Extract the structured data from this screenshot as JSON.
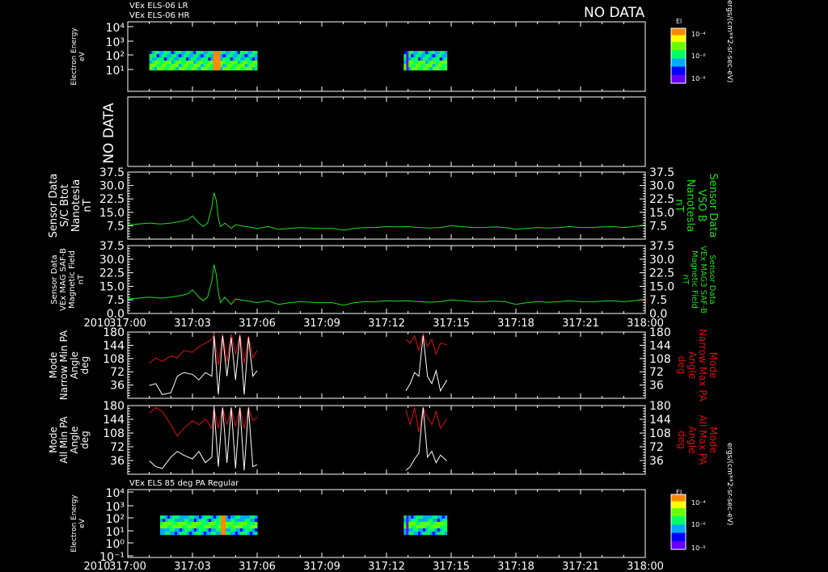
{
  "header": {
    "line1": "VEx ELS-06 LR",
    "line2": "VEx ELS-06 HR",
    "nodata": "NO DATA",
    "footer_title": "VEx ELS 85 deg PA Regular"
  },
  "colorbar": {
    "title": "El",
    "ticks": [
      "10⁻⁴",
      "10⁻⁶",
      "10⁻⁸"
    ],
    "unit": "ergs/(cm**2-sr-sec-eV)"
  },
  "colors": {
    "background": "#000000",
    "axes": "#ffffff",
    "green": "#22dd22",
    "red": "#dd1111",
    "white": "#ffffff"
  },
  "chart_data": [
    {
      "type": "heatmap",
      "name": "energy_top",
      "ylabel": "Electron Energy\neV",
      "yticks": [
        "10⁴",
        "10³",
        "10²",
        "10¹"
      ],
      "data_segments": [
        [
          "317:01",
          "317:06"
        ],
        [
          "317:12.8",
          "317:14.8"
        ]
      ],
      "note": "color spectrogram"
    },
    {
      "type": "line",
      "name": "nodata_panel",
      "ylabel": "NO DATA"
    },
    {
      "type": "line",
      "name": "bmag_sc",
      "ylabel_left": "Sensor Data\nS/C Btot\nNanotesla\nnT",
      "ylabel_right": "Sensor Data\nVSO B\nNanotesla\nnT",
      "ylim": [
        0,
        37.5
      ],
      "yticks": [
        "37.5",
        "30.0",
        "22.5",
        "15.0",
        "7.5"
      ],
      "color": "#22dd22",
      "x": [
        0,
        0.5,
        1.0,
        1.5,
        2.0,
        2.5,
        2.8,
        3.0,
        3.3,
        3.5,
        3.7,
        3.9,
        4.0,
        4.1,
        4.2,
        4.3,
        4.5,
        4.8,
        5.0,
        5.5,
        6.0,
        6.5,
        7.0,
        7.5,
        8.0,
        8.5,
        9.0,
        9.5,
        10.0,
        10.5,
        11.0,
        11.5,
        12.0,
        12.5,
        13.0,
        13.5,
        14.0,
        14.5,
        15.0,
        15.5,
        16.0,
        16.5,
        17.0,
        17.5,
        18.0,
        18.5,
        19.0,
        19.5,
        20.0,
        20.5,
        21.0,
        21.5,
        22.0,
        22.5,
        23.0,
        23.5,
        24.0
      ],
      "y": [
        8,
        8.5,
        9,
        8.5,
        9,
        10,
        11,
        13,
        9,
        7,
        9,
        18,
        26,
        22,
        12,
        7,
        9,
        6,
        8,
        7,
        6,
        7,
        5.5,
        6,
        6.5,
        6.2,
        6,
        6,
        5,
        6,
        6.5,
        6.5,
        7,
        6.8,
        7,
        6.5,
        6.2,
        6.5,
        7.5,
        7,
        6.5,
        6.5,
        6.8,
        6.5,
        5.5,
        6,
        6.5,
        6.2,
        6.5,
        7,
        6.5,
        6.5,
        6.8,
        7,
        6.5,
        7,
        8
      ]
    },
    {
      "type": "line",
      "name": "bmag_vex",
      "ylabel_left": "Sensor Data\nVEx MAG SAF-B\nMagnetic Field\nnT",
      "ylabel_right": "Sensor Data\nVEx MAG3 SAF-B\nMagnetic Field\nnT",
      "ylim": [
        0,
        37.5
      ],
      "yticks": [
        "37.5",
        "30.0",
        "22.5",
        "15.0",
        "7.5",
        "0.0"
      ],
      "color": "#22dd22",
      "x": [
        0,
        0.5,
        1.0,
        1.5,
        2.0,
        2.5,
        2.8,
        3.0,
        3.3,
        3.5,
        3.7,
        3.9,
        4.0,
        4.1,
        4.2,
        4.3,
        4.5,
        4.8,
        5.0,
        5.5,
        6.0,
        6.5,
        7.0,
        7.5,
        8.0,
        8.5,
        9.0,
        9.5,
        10.0,
        10.5,
        11.0,
        11.5,
        12.0,
        12.5,
        13.0,
        13.5,
        14.0,
        14.5,
        15.0,
        15.5,
        16.0,
        16.5,
        17.0,
        17.5,
        18.0,
        18.5,
        19.0,
        19.5,
        20.0,
        20.5,
        21.0,
        21.5,
        22.0,
        22.5,
        23.0,
        23.5,
        24.0
      ],
      "y": [
        8,
        8.5,
        9,
        8.5,
        9,
        10,
        11,
        13,
        9,
        7,
        9,
        18,
        27,
        22,
        12,
        6,
        9,
        5,
        8,
        7,
        6,
        7,
        5,
        6,
        6.5,
        6.2,
        6,
        6,
        4.5,
        6,
        6.5,
        6.5,
        7,
        6.8,
        7,
        6.5,
        6.2,
        6.5,
        7.5,
        7,
        6.5,
        6.5,
        6.8,
        6.5,
        5,
        6,
        6.5,
        6.2,
        6.5,
        7,
        6.5,
        6.5,
        6.8,
        7,
        6.5,
        7,
        8
      ]
    },
    {
      "type": "line",
      "name": "pa_narrow",
      "ylabel_left": "Mode\nNarrow Min PA\nAngle\ndeg",
      "ylabel_right": "Mode\nNarrow Max PA\nAngle\ndeg",
      "ylim": [
        0,
        180
      ],
      "yticks": [
        "180",
        "144",
        "108",
        "72",
        "36"
      ],
      "series": [
        {
          "name": "Narrow Max PA",
          "color": "#dd1111",
          "segments": [
            {
              "x": [
                1.0,
                1.3,
                1.6,
                2.0,
                2.3,
                2.6,
                3.0,
                3.3,
                3.6,
                3.9,
                4.0,
                4.2,
                4.4,
                4.6,
                4.8,
                5.0,
                5.2,
                5.4,
                5.6,
                5.8,
                6.0
              ],
              "y": [
                95,
                110,
                100,
                115,
                110,
                130,
                125,
                140,
                150,
                160,
                175,
                90,
                175,
                100,
                175,
                120,
                175,
                95,
                170,
                110,
                130
              ]
            },
            {
              "x": [
                12.9,
                13.1,
                13.3,
                13.5,
                13.7,
                13.9,
                14.1,
                14.3,
                14.5,
                14.8
              ],
              "y": [
                160,
                150,
                170,
                130,
                175,
                140,
                160,
                120,
                150,
                145
              ]
            }
          ]
        },
        {
          "name": "Narrow Min PA",
          "color": "#ffffff",
          "segments": [
            {
              "x": [
                1.0,
                1.3,
                1.6,
                2.0,
                2.3,
                2.6,
                3.0,
                3.3,
                3.6,
                3.9,
                4.0,
                4.2,
                4.4,
                4.6,
                4.8,
                5.0,
                5.2,
                5.4,
                5.6,
                5.8,
                6.0
              ],
              "y": [
                35,
                40,
                10,
                15,
                60,
                70,
                65,
                50,
                70,
                60,
                170,
                10,
                170,
                60,
                165,
                50,
                170,
                10,
                165,
                60,
                75
              ]
            },
            {
              "x": [
                12.9,
                13.1,
                13.3,
                13.5,
                13.7,
                13.9,
                14.1,
                14.3,
                14.5,
                14.8
              ],
              "y": [
                20,
                40,
                70,
                60,
                170,
                60,
                40,
                75,
                20,
                50
              ]
            }
          ]
        }
      ]
    },
    {
      "type": "line",
      "name": "pa_all",
      "ylabel_left": "Mode\nAll Min PA\nAngle\ndeg",
      "ylabel_right": "Mode\nAll Max PA\nAngle\ndeg",
      "ylim": [
        0,
        180
      ],
      "yticks": [
        "180",
        "144",
        "108",
        "72",
        "36"
      ],
      "series": [
        {
          "name": "All Max PA",
          "color": "#dd1111",
          "segments": [
            {
              "x": [
                1.0,
                1.3,
                1.6,
                2.0,
                2.3,
                2.6,
                3.0,
                3.3,
                3.6,
                3.9,
                4.0,
                4.2,
                4.4,
                4.6,
                4.8,
                5.0,
                5.2,
                5.4,
                5.6,
                5.8,
                6.0
              ],
              "y": [
                160,
                175,
                165,
                130,
                100,
                120,
                140,
                130,
                145,
                120,
                175,
                120,
                175,
                130,
                175,
                125,
                175,
                120,
                175,
                140,
                150
              ]
            },
            {
              "x": [
                12.9,
                13.1,
                13.3,
                13.5,
                13.7,
                13.9,
                14.1,
                14.3,
                14.5,
                14.8
              ],
              "y": [
                170,
                130,
                175,
                110,
                175,
                150,
                130,
                165,
                120,
                145
              ]
            }
          ]
        },
        {
          "name": "All Min PA",
          "color": "#ffffff",
          "segments": [
            {
              "x": [
                1.0,
                1.3,
                1.6,
                2.0,
                2.3,
                2.6,
                3.0,
                3.3,
                3.6,
                3.9,
                4.0,
                4.2,
                4.4,
                4.6,
                4.8,
                5.0,
                5.2,
                5.4,
                5.6,
                5.8,
                6.0
              ],
              "y": [
                35,
                20,
                15,
                45,
                60,
                50,
                40,
                60,
                30,
                45,
                175,
                20,
                175,
                30,
                175,
                15,
                175,
                10,
                175,
                20,
                25
              ]
            },
            {
              "x": [
                12.9,
                13.1,
                13.3,
                13.5,
                13.7,
                13.9,
                14.1,
                14.3,
                14.5,
                14.8
              ],
              "y": [
                10,
                20,
                40,
                55,
                175,
                45,
                60,
                30,
                50,
                35
              ]
            }
          ]
        }
      ]
    },
    {
      "type": "heatmap",
      "name": "energy_bottom",
      "ylabel": "Electron Energy\neV",
      "yticks": [
        "10⁴",
        "10³",
        "10²",
        "10¹",
        "10⁰",
        "10⁻¹"
      ],
      "data_segments": [
        [
          "317:01.5",
          "317:06"
        ],
        [
          "317:12.8",
          "317:14.8"
        ]
      ],
      "note": "color spectrogram"
    }
  ],
  "time_axis": {
    "year": "2010",
    "labels": [
      "317:00",
      "317:03",
      "317:06",
      "317:09",
      "317:12",
      "317:15",
      "317:18",
      "317:21",
      "318:00"
    ],
    "range_minutes": [
      0,
      24
    ]
  }
}
